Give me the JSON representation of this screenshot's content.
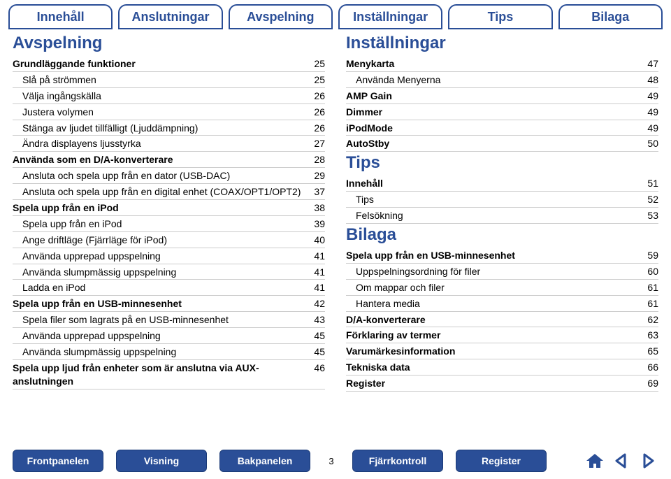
{
  "tabs": [
    "Innehåll",
    "Anslutningar",
    "Avspelning",
    "Inställningar",
    "Tips",
    "Bilaga"
  ],
  "left": {
    "heading": "Avspelning",
    "rows": [
      {
        "label": "Grundläggande funktioner",
        "page": "25",
        "bold": true,
        "ind": 0
      },
      {
        "label": "Slå på strömmen",
        "page": "25",
        "bold": false,
        "ind": 1
      },
      {
        "label": "Välja ingångskälla",
        "page": "26",
        "bold": false,
        "ind": 1
      },
      {
        "label": "Justera volymen",
        "page": "26",
        "bold": false,
        "ind": 1
      },
      {
        "label": "Stänga av ljudet tillfälligt (Ljuddämpning)",
        "page": "26",
        "bold": false,
        "ind": 1
      },
      {
        "label": "Ändra displayens ljusstyrka",
        "page": "27",
        "bold": false,
        "ind": 1
      },
      {
        "label": "Använda som en D/A-konverterare",
        "page": "28",
        "bold": true,
        "ind": 0
      },
      {
        "label": "Ansluta och spela upp från en dator (USB-DAC)",
        "page": "29",
        "bold": false,
        "ind": 1
      },
      {
        "label": "Ansluta och spela upp från en digital enhet (COAX/OPT1/OPT2)",
        "page": "37",
        "bold": false,
        "ind": 1
      },
      {
        "label": "Spela upp från en iPod",
        "page": "38",
        "bold": true,
        "ind": 0
      },
      {
        "label": "Spela upp från en iPod",
        "page": "39",
        "bold": false,
        "ind": 1
      },
      {
        "label": "Ange driftläge (Fjärrläge för iPod)",
        "page": "40",
        "bold": false,
        "ind": 1
      },
      {
        "label": "Använda upprepad uppspelning",
        "page": "41",
        "bold": false,
        "ind": 1
      },
      {
        "label": "Använda slumpmässig uppspelning",
        "page": "41",
        "bold": false,
        "ind": 1
      },
      {
        "label": "Ladda en iPod",
        "page": "41",
        "bold": false,
        "ind": 1
      },
      {
        "label": "Spela upp från en USB-minnesenhet",
        "page": "42",
        "bold": true,
        "ind": 0
      },
      {
        "label": "Spela filer som lagrats på en USB-minnesenhet",
        "page": "43",
        "bold": false,
        "ind": 1
      },
      {
        "label": "Använda upprepad uppspelning",
        "page": "45",
        "bold": false,
        "ind": 1
      },
      {
        "label": "Använda slumpmässig uppspelning",
        "page": "45",
        "bold": false,
        "ind": 1
      },
      {
        "label": "Spela upp ljud från enheter som är anslutna via AUX-anslutningen",
        "page": "46",
        "bold": true,
        "ind": 0
      }
    ]
  },
  "right": [
    {
      "heading": "Inställningar",
      "rows": [
        {
          "label": "Menykarta",
          "page": "47",
          "bold": true,
          "ind": 0
        },
        {
          "label": "Använda Menyerna",
          "page": "48",
          "bold": false,
          "ind": 1
        },
        {
          "label": "AMP Gain",
          "page": "49",
          "bold": true,
          "ind": 0
        },
        {
          "label": "Dimmer",
          "page": "49",
          "bold": true,
          "ind": 0
        },
        {
          "label": "iPodMode",
          "page": "49",
          "bold": true,
          "ind": 0
        },
        {
          "label": "AutoStby",
          "page": "50",
          "bold": true,
          "ind": 0
        }
      ]
    },
    {
      "heading": "Tips",
      "rows": [
        {
          "label": "Innehåll",
          "page": "51",
          "bold": true,
          "ind": 0
        },
        {
          "label": "Tips",
          "page": "52",
          "bold": false,
          "ind": 1
        },
        {
          "label": "Felsökning",
          "page": "53",
          "bold": false,
          "ind": 1
        }
      ]
    },
    {
      "heading": "Bilaga",
      "rows": [
        {
          "label": "Spela upp från en USB-minnesenhet",
          "page": "59",
          "bold": true,
          "ind": 0
        },
        {
          "label": "Uppspelningsordning för filer",
          "page": "60",
          "bold": false,
          "ind": 1
        },
        {
          "label": "Om mappar och filer",
          "page": "61",
          "bold": false,
          "ind": 1
        },
        {
          "label": "Hantera media",
          "page": "61",
          "bold": false,
          "ind": 1
        },
        {
          "label": "D/A-konverterare",
          "page": "62",
          "bold": true,
          "ind": 0
        },
        {
          "label": "Förklaring av termer",
          "page": "63",
          "bold": true,
          "ind": 0
        },
        {
          "label": "Varumärkesinformation",
          "page": "65",
          "bold": true,
          "ind": 0
        },
        {
          "label": "Tekniska data",
          "page": "66",
          "bold": true,
          "ind": 0
        },
        {
          "label": "Register",
          "page": "69",
          "bold": true,
          "ind": 0
        }
      ]
    }
  ],
  "footer": {
    "buttons": [
      "Frontpanelen",
      "Visning",
      "Bakpanelen"
    ],
    "pageno": "3",
    "buttons2": [
      "Fjärrkontroll",
      "Register"
    ]
  }
}
